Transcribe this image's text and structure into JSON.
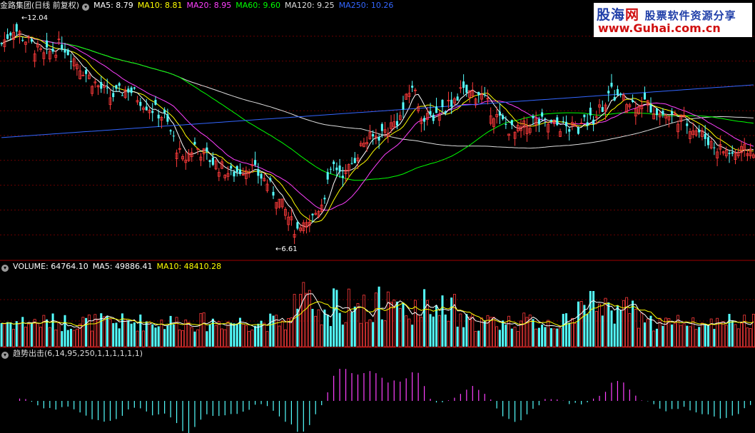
{
  "header": {
    "stock": "金路集团(日线 前复权)",
    "ma": [
      {
        "label": "MA5: 8.79",
        "color": "#ffffff"
      },
      {
        "label": "MA10: 8.81",
        "color": "#ffff00"
      },
      {
        "label": "MA20: 8.95",
        "color": "#ff40ff"
      },
      {
        "label": "MA60: 9.60",
        "color": "#00ff00"
      },
      {
        "label": "MA120: 9.25",
        "color": "#dddddd"
      },
      {
        "label": "MA250: 10.26",
        "color": "#3366ff"
      }
    ]
  },
  "volume_header": {
    "title": "VOLUME: 64764.10",
    "ma5": "MA5: 49886.41",
    "ma10": "MA10: 48410.28"
  },
  "indicator_header": {
    "title": "趋势出击(6,14,95,250,1,1,1,1,1,1)"
  },
  "watermark": {
    "brand_blue": "股海",
    "brand_red": "网",
    "tagline": "股票软件资源分享",
    "url": "www.Guhai.com.cn"
  },
  "annotations": {
    "high": "12.04",
    "low": "6.61"
  },
  "colors": {
    "up": "#ff3b3b",
    "down": "#54ffff",
    "indicator_pos": "#ff40ff",
    "indicator_neg": "#54ffff",
    "grid": "#6a0000"
  },
  "chart_data": {
    "type": "candlestick",
    "title": "金路集团(日线 前复权)",
    "price_range": [
      6.2,
      12.3
    ],
    "anchors": [
      [
        0,
        11.5
      ],
      [
        4,
        11.9
      ],
      [
        8,
        11.6
      ],
      [
        14,
        11.2
      ],
      [
        20,
        11.5
      ],
      [
        30,
        10.6
      ],
      [
        36,
        10.2
      ],
      [
        42,
        10.4
      ],
      [
        48,
        10.0
      ],
      [
        54,
        9.7
      ],
      [
        60,
        8.6
      ],
      [
        64,
        9.0
      ],
      [
        70,
        8.6
      ],
      [
        76,
        8.3
      ],
      [
        82,
        8.5
      ],
      [
        88,
        8.1
      ],
      [
        94,
        7.4
      ],
      [
        98,
        6.8
      ],
      [
        102,
        7.1
      ],
      [
        106,
        7.6
      ],
      [
        110,
        8.5
      ],
      [
        114,
        8.3
      ],
      [
        120,
        9.1
      ],
      [
        126,
        9.3
      ],
      [
        132,
        9.7
      ],
      [
        136,
        10.5
      ],
      [
        140,
        9.6
      ],
      [
        146,
        9.9
      ],
      [
        152,
        10.3
      ],
      [
        158,
        10.3
      ],
      [
        164,
        9.7
      ],
      [
        170,
        9.3
      ],
      [
        176,
        9.6
      ],
      [
        184,
        9.5
      ],
      [
        190,
        9.4
      ],
      [
        196,
        9.7
      ],
      [
        202,
        10.3
      ],
      [
        208,
        10.0
      ],
      [
        212,
        10.1
      ],
      [
        218,
        9.8
      ],
      [
        224,
        9.7
      ],
      [
        230,
        9.4
      ],
      [
        236,
        9.0
      ],
      [
        242,
        8.8
      ],
      [
        248,
        8.9
      ]
    ],
    "volume_scale_max": 100000,
    "indicator_range": [
      -1,
      1
    ]
  }
}
